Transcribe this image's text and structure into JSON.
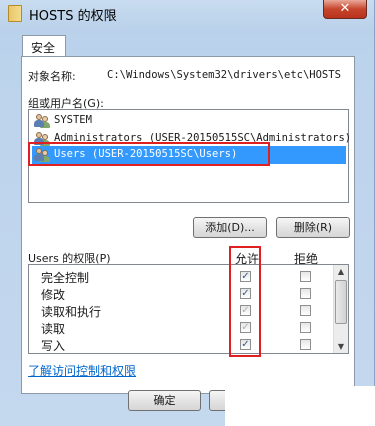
{
  "window": {
    "title": "HOSTS 的权限",
    "close_label": "✕"
  },
  "tabs": [
    {
      "label": "安全"
    }
  ],
  "object": {
    "label": "对象名称:",
    "path": "C:\\Windows\\System32\\drivers\\etc\\HOSTS"
  },
  "groups": {
    "label": "组或用户名(G):",
    "items": [
      {
        "label": "SYSTEM"
      },
      {
        "label": "Administrators (USER-20150515SC\\Administrators)"
      },
      {
        "label": "Users (USER-20150515SC\\Users)",
        "selected": true
      }
    ],
    "add_label": "添加(D)...",
    "remove_label": "删除(R)"
  },
  "permissions": {
    "header": "Users 的权限(P)",
    "allow_header": "允许",
    "deny_header": "拒绝",
    "rows": [
      {
        "name": "完全控制",
        "allow": "checked",
        "deny": "unchecked"
      },
      {
        "name": "修改",
        "allow": "checked",
        "deny": "unchecked"
      },
      {
        "name": "读取和执行",
        "allow": "checked-gray",
        "deny": "unchecked"
      },
      {
        "name": "读取",
        "allow": "checked-gray",
        "deny": "unchecked"
      },
      {
        "name": "写入",
        "allow": "checked",
        "deny": "unchecked"
      }
    ]
  },
  "link_label": "了解访问控制和权限",
  "footer": {
    "ok_label": "确定"
  },
  "colors": {
    "highlight": "#3399ff",
    "annotation_red": "#e02020",
    "link": "#0066cc"
  },
  "icons": [
    "folder-icon",
    "close-icon",
    "users-icon",
    "checkbox-check",
    "scroll-up-arrow",
    "scroll-down-arrow"
  ]
}
